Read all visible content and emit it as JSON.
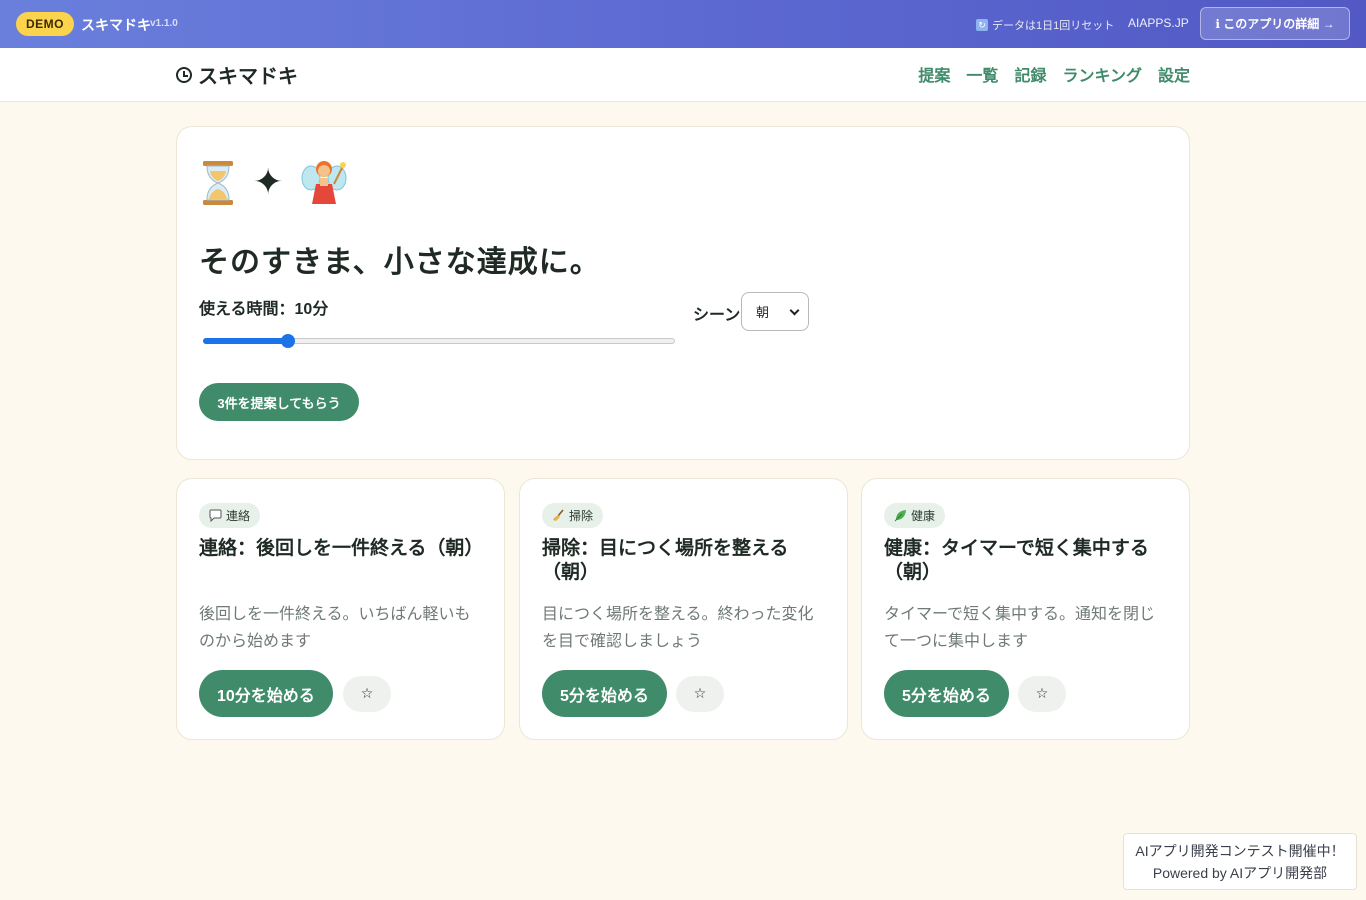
{
  "demo_bar": {
    "badge": "DEMO",
    "app_name": "スキマドキ",
    "version": "v1.1.0",
    "reset_note": "データは1日1回リセット",
    "site": "AIAPPS.JP",
    "detail_button": "ℹ このアプリの詳細 →"
  },
  "nav": {
    "brand": "スキマドキ",
    "links": [
      "提案",
      "一覧",
      "記録",
      "ランキング",
      "設定"
    ]
  },
  "hero": {
    "icons": [
      "hourglass-icon",
      "sparkle-icon",
      "fairy-icon"
    ],
    "sparkle_glyph": "✦",
    "title": "そのすきま、小さな達成に。",
    "time_label": "使える時間：10分",
    "time_value": 10,
    "time_slider_fraction": 0.18,
    "scene_label": "シーン",
    "scene_selected": "朝",
    "suggest_button": "3件を提案してもらう"
  },
  "cards": [
    {
      "tag_icon": "speech-bubble-icon",
      "tag": "連絡",
      "title": "連絡：後回しを一件終える（朝）",
      "desc": "後回しを一件終える。いちばん軽いものから始めます",
      "start_button": "10分を始める",
      "star": "☆"
    },
    {
      "tag_icon": "broom-icon",
      "tag": "掃除",
      "title": "掃除：目につく場所を整える（朝）",
      "desc": "目につく場所を整える。終わった変化を目で確認しましょう",
      "start_button": "5分を始める",
      "star": "☆"
    },
    {
      "tag_icon": "leaf-icon",
      "tag": "健康",
      "title": "健康：タイマーで短く集中する（朝）",
      "desc": "タイマーで短く集中する。通知を閉じて一つに集中します",
      "start_button": "5分を始める",
      "star": "☆"
    }
  ],
  "contest": {
    "line1": "AIアプリ開発コンテスト開催中！",
    "line2": "Powered by AIアプリ開発部"
  },
  "colors": {
    "accent": "#3f8b6a",
    "background": "#fdf9ee",
    "demo_badge": "#fcd34d",
    "slider": "#1a73e8"
  }
}
